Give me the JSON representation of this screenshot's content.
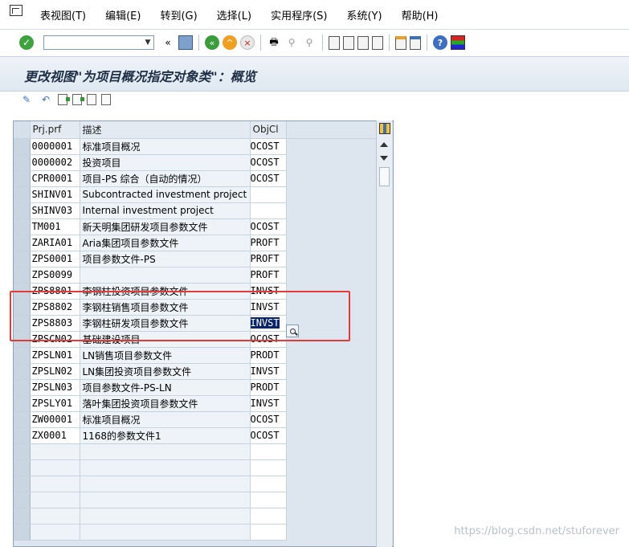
{
  "menubar": {
    "items": [
      "表视图(T)",
      "编辑(E)",
      "转到(G)",
      "选择(L)",
      "实用程序(S)",
      "系统(Y)",
      "帮助(H)"
    ]
  },
  "toolbar": {
    "command_field_value": "",
    "icons": [
      "enter-icon",
      "back-nav-icon",
      "save-icon",
      "back-icon",
      "exit-icon",
      "cancel-icon",
      "print-icon",
      "find-icon",
      "find-next-icon",
      "first-page-icon",
      "previous-page-icon",
      "next-page-icon",
      "last-page-icon",
      "new-session-icon",
      "shortcut-icon",
      "help-icon",
      "customize-layout-icon"
    ]
  },
  "page": {
    "title": "更改视图\"为项目概况指定对象类\"：概览"
  },
  "app_toolbar": {
    "icons": [
      "display-change-icon",
      "undo-icon",
      "new-entries-icon",
      "copy-as-icon",
      "delete-icon",
      "select-all-icon"
    ]
  },
  "table": {
    "columns": [
      "Prj.prf",
      "描述",
      "ObjCl"
    ],
    "rows": [
      {
        "prj": "0000001",
        "desc": "标准项目概况",
        "objcl": "OCOST"
      },
      {
        "prj": "0000002",
        "desc": "投资项目",
        "objcl": "OCOST"
      },
      {
        "prj": "CPR0001",
        "desc": "项目-PS 综合（自动的情况）",
        "objcl": "OCOST"
      },
      {
        "prj": "SHINV01",
        "desc": "Subcontracted investment project",
        "objcl": ""
      },
      {
        "prj": "SHINV03",
        "desc": "Internal investment project",
        "objcl": ""
      },
      {
        "prj": "TM001",
        "desc": "新天明集团研发项目参数文件",
        "objcl": "OCOST"
      },
      {
        "prj": "ZARIA01",
        "desc": "Aria集团项目参数文件",
        "objcl": "PROFT"
      },
      {
        "prj": "ZPS0001",
        "desc": "项目参数文件-PS",
        "objcl": "PROFT"
      },
      {
        "prj": "ZPS0099",
        "desc": "",
        "objcl": "PROFT"
      },
      {
        "prj": "ZPS8801",
        "desc": "李钢柱投资项目参数文件",
        "objcl": "INVST"
      },
      {
        "prj": "ZPS8802",
        "desc": "李钢柱销售项目参数文件",
        "objcl": "INVST"
      },
      {
        "prj": "ZPS8803",
        "desc": "李钢柱研发项目参数文件",
        "objcl": "INVST"
      },
      {
        "prj": "ZPSCN02",
        "desc": "基础建设项目",
        "objcl": "OCOST"
      },
      {
        "prj": "ZPSLN01",
        "desc": "LN销售项目参数文件",
        "objcl": "PRODT"
      },
      {
        "prj": "ZPSLN02",
        "desc": "LN集团投资项目参数文件",
        "objcl": "INVST"
      },
      {
        "prj": "ZPSLN03",
        "desc": "项目参数文件-PS-LN",
        "objcl": "PRODT"
      },
      {
        "prj": "ZPSLY01",
        "desc": "落叶集团投资项目参数文件",
        "objcl": "INVST"
      },
      {
        "prj": "ZW00001",
        "desc": "标准项目概况",
        "objcl": "OCOST"
      },
      {
        "prj": "ZX0001",
        "desc": "1168的参数文件1",
        "objcl": "OCOST"
      }
    ],
    "focused_row": 11
  },
  "watermark": "https://blog.csdn.net/stuforever",
  "colors": {
    "highlight_box": "#e53a3a",
    "focused_cell_bg": "#0a246a"
  }
}
